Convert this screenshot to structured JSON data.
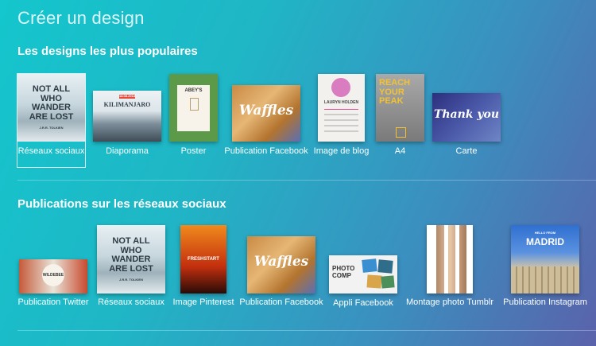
{
  "page": {
    "title": "Créer un design"
  },
  "sections": [
    {
      "title": "Les designs les plus populaires",
      "items": [
        {
          "label": "Réseaux sociaux",
          "icon": "notallwho-thumbnail",
          "selected": true
        },
        {
          "label": "Diaporama",
          "icon": "kilimanjaro-thumbnail"
        },
        {
          "label": "Poster",
          "icon": "abeys-poster-thumbnail"
        },
        {
          "label": "Publication Facebook",
          "icon": "waffles-thumbnail"
        },
        {
          "label": "Image de blog",
          "icon": "lauryn-holden-thumbnail"
        },
        {
          "label": "A4",
          "icon": "reach-your-peak-thumbnail"
        },
        {
          "label": "Carte",
          "icon": "thank-you-card-thumbnail"
        }
      ]
    },
    {
      "title": "Publications sur les réseaux sociaux",
      "items": [
        {
          "label": "Publication Twitter",
          "icon": "wildebee-thumbnail"
        },
        {
          "label": "Réseaux sociaux",
          "icon": "notallwho-thumbnail"
        },
        {
          "label": "Image Pinterest",
          "icon": "freshstart-thumbnail"
        },
        {
          "label": "Publication Facebook",
          "icon": "waffles-thumbnail"
        },
        {
          "label": "Appli Facebook",
          "icon": "photo-comp-thumbnail"
        },
        {
          "label": "Montage photo Tumblr",
          "icon": "tumblr-montage-thumbnail"
        },
        {
          "label": "Publication Instagram",
          "icon": "madrid-thumbnail"
        }
      ]
    }
  ],
  "thumb_text": {
    "notallwho": "NOT ALL WHO WANDER ARE LOST",
    "notallwho_author": "J.R.R. TOLKIEN",
    "kilimanjaro": "KILIMANJARO",
    "kilimanjaro_date": "18.08.2018",
    "abeys": "ABEY'S",
    "waffles": "Waffles",
    "lauryn": "LAURYN HOLDEN",
    "reach": "REACH YOUR PEAK",
    "thankyou": "Thank you",
    "wildebee": "WILDEBEE",
    "freshstart": "FRESHSTART",
    "photocomp": "PHOTO COMP",
    "hellofrom": "HELLO FROM",
    "madrid": "MADRID"
  }
}
